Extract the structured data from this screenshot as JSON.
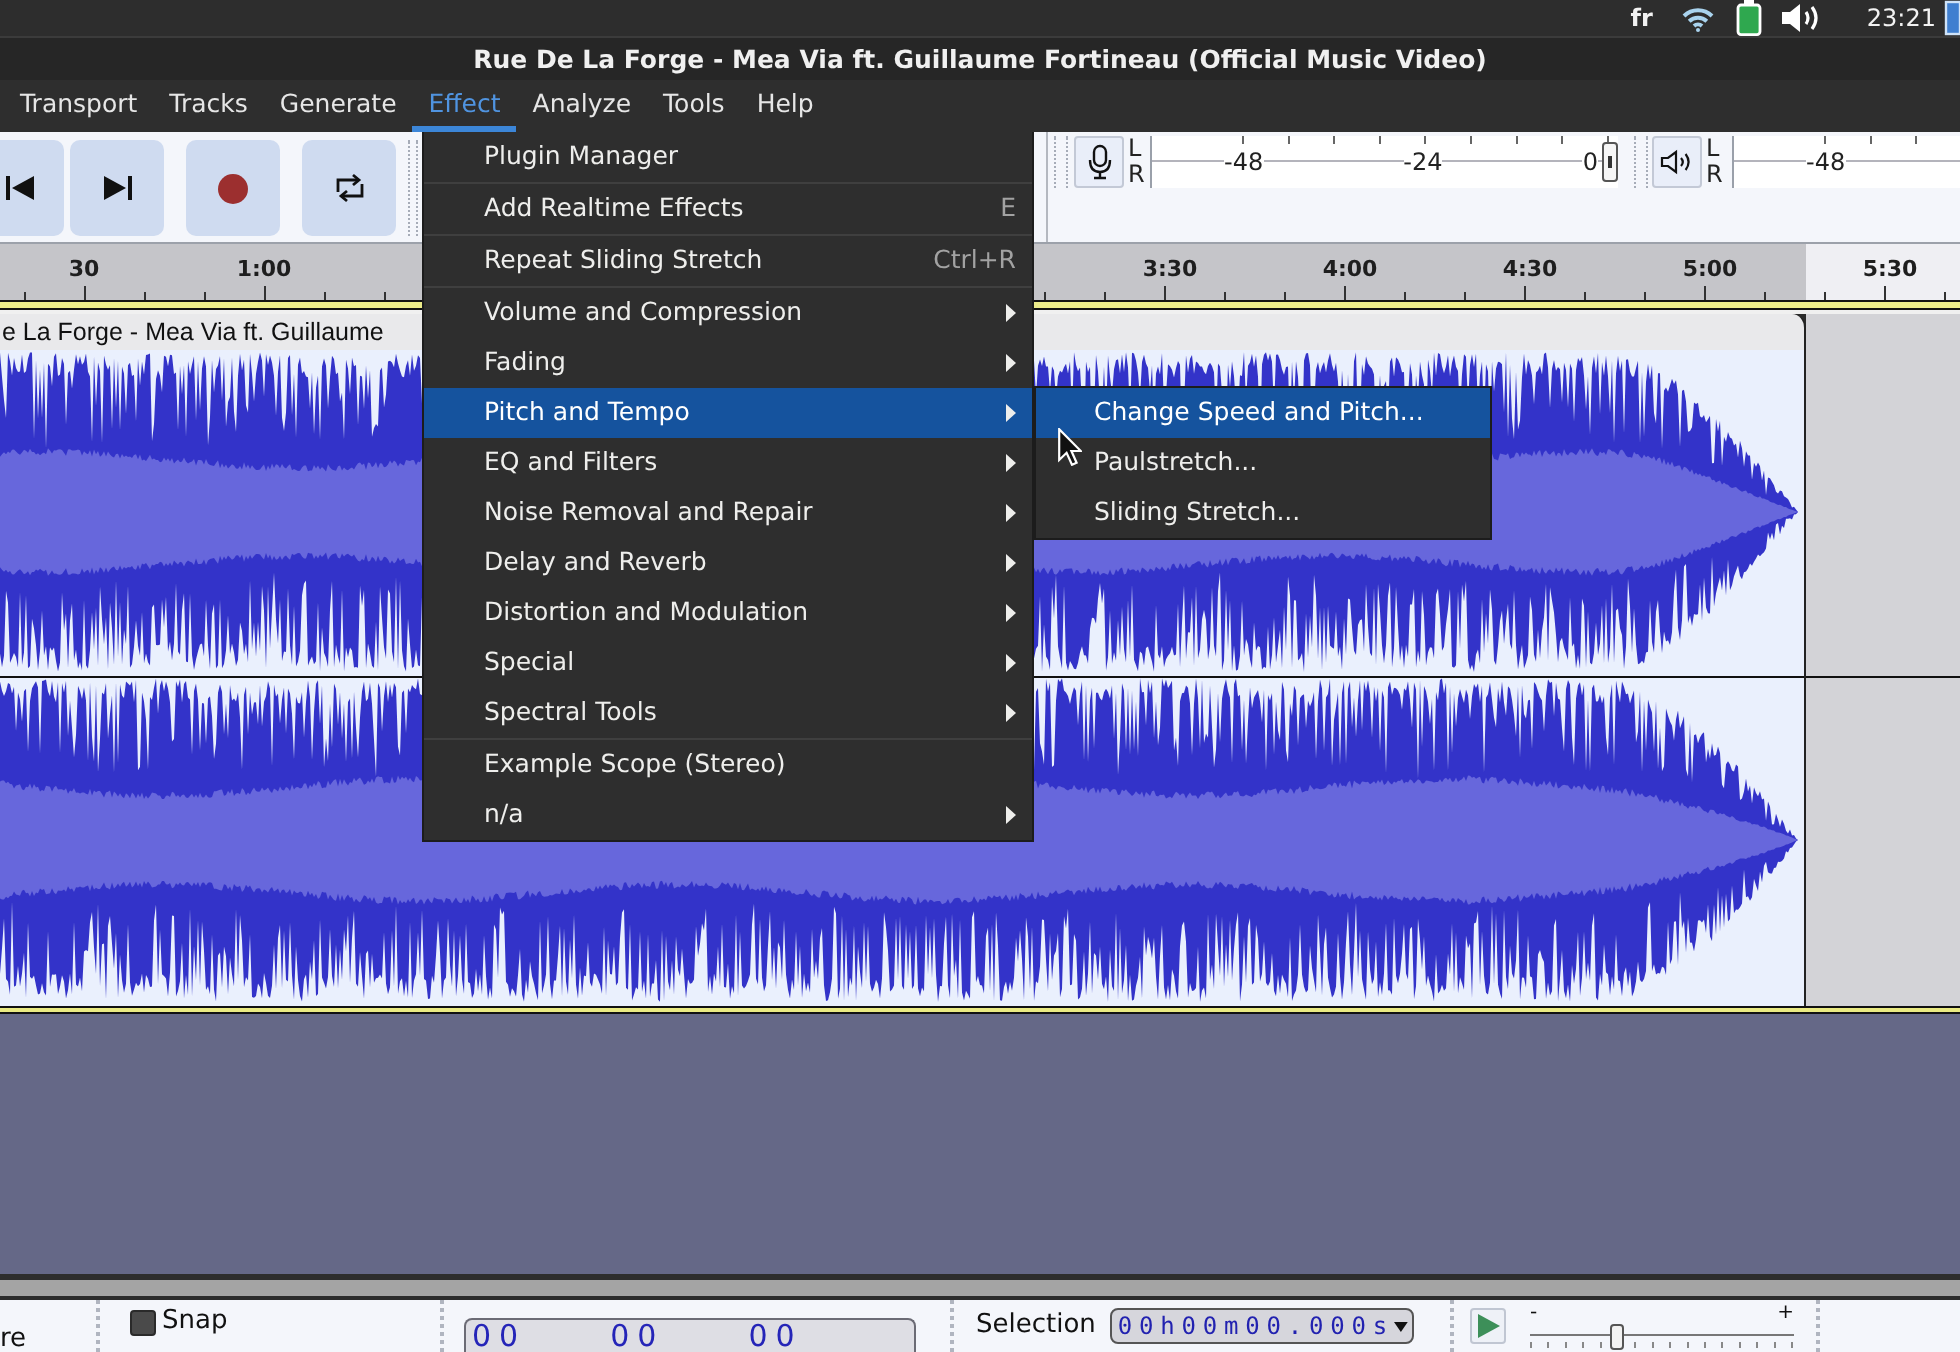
{
  "system_tray": {
    "keyboard_layout": "fr",
    "clock": "23:21"
  },
  "window": {
    "title": "Rue De La Forge - Mea Via ft. Guillaume Fortineau (Official Music Video)"
  },
  "menu_bar": [
    {
      "label": "Transport",
      "selected": false
    },
    {
      "label": "Tracks",
      "selected": false
    },
    {
      "label": "Generate",
      "selected": false
    },
    {
      "label": "Effect",
      "selected": true
    },
    {
      "label": "Analyze",
      "selected": false
    },
    {
      "label": "Tools",
      "selected": false
    },
    {
      "label": "Help",
      "selected": false
    }
  ],
  "meters": [
    {
      "kind": "recording",
      "channels": [
        "L",
        "R"
      ],
      "scale": [
        "-48",
        "-24",
        "0"
      ],
      "level": 1
    },
    {
      "kind": "playback",
      "channels": [
        "L",
        "R"
      ],
      "scale": [
        "-48"
      ]
    }
  ],
  "timeline": {
    "labels_start": [
      "30",
      "1:00"
    ],
    "labels_end": [
      "3:30",
      "4:00",
      "4:30",
      "5:00",
      "5:30"
    ]
  },
  "track": {
    "clip_title": "e La Forge - Mea Via ft. Guillaume"
  },
  "effect_menu": {
    "items": [
      {
        "kind": "command",
        "label": "Plugin Manager",
        "selected": false
      },
      {
        "kind": "separator"
      },
      {
        "kind": "command",
        "label": "Add Realtime Effects",
        "shortcut": "E",
        "selected": false
      },
      {
        "kind": "separator"
      },
      {
        "kind": "command",
        "label": "Repeat Sliding Stretch",
        "shortcut": "Ctrl+R",
        "selected": false
      },
      {
        "kind": "separator"
      },
      {
        "kind": "submenu",
        "label": "Volume and Compression",
        "selected": false
      },
      {
        "kind": "submenu",
        "label": "Fading",
        "selected": false
      },
      {
        "kind": "submenu",
        "label": "Pitch and Tempo",
        "selected": true,
        "children": [
          {
            "label": "Change Speed and Pitch...",
            "selected": true
          },
          {
            "label": "Paulstretch...",
            "selected": false
          },
          {
            "label": "Sliding Stretch...",
            "selected": false
          }
        ]
      },
      {
        "kind": "submenu",
        "label": "EQ and Filters",
        "selected": false
      },
      {
        "kind": "submenu",
        "label": "Noise Removal and Repair",
        "selected": false
      },
      {
        "kind": "submenu",
        "label": "Delay and Reverb",
        "selected": false
      },
      {
        "kind": "submenu",
        "label": "Distortion and Modulation",
        "selected": false
      },
      {
        "kind": "submenu",
        "label": "Special",
        "selected": false
      },
      {
        "kind": "submenu",
        "label": "Spectral Tools",
        "selected": false
      },
      {
        "kind": "separator"
      },
      {
        "kind": "command",
        "label": "Example Scope (Stereo)",
        "selected": false
      },
      {
        "kind": "submenu",
        "label": "n/a",
        "selected": false
      }
    ]
  },
  "bottom_toolbar": {
    "partial_label": "re",
    "snap": {
      "label": "Snap",
      "checked": false
    },
    "time_display": [
      "00",
      "00",
      "00"
    ],
    "selection": {
      "label": "Selection",
      "value": "00h00m00.000s"
    },
    "play_speed": {
      "min_label": "-",
      "max_label": "+",
      "level": 0.32
    }
  }
}
